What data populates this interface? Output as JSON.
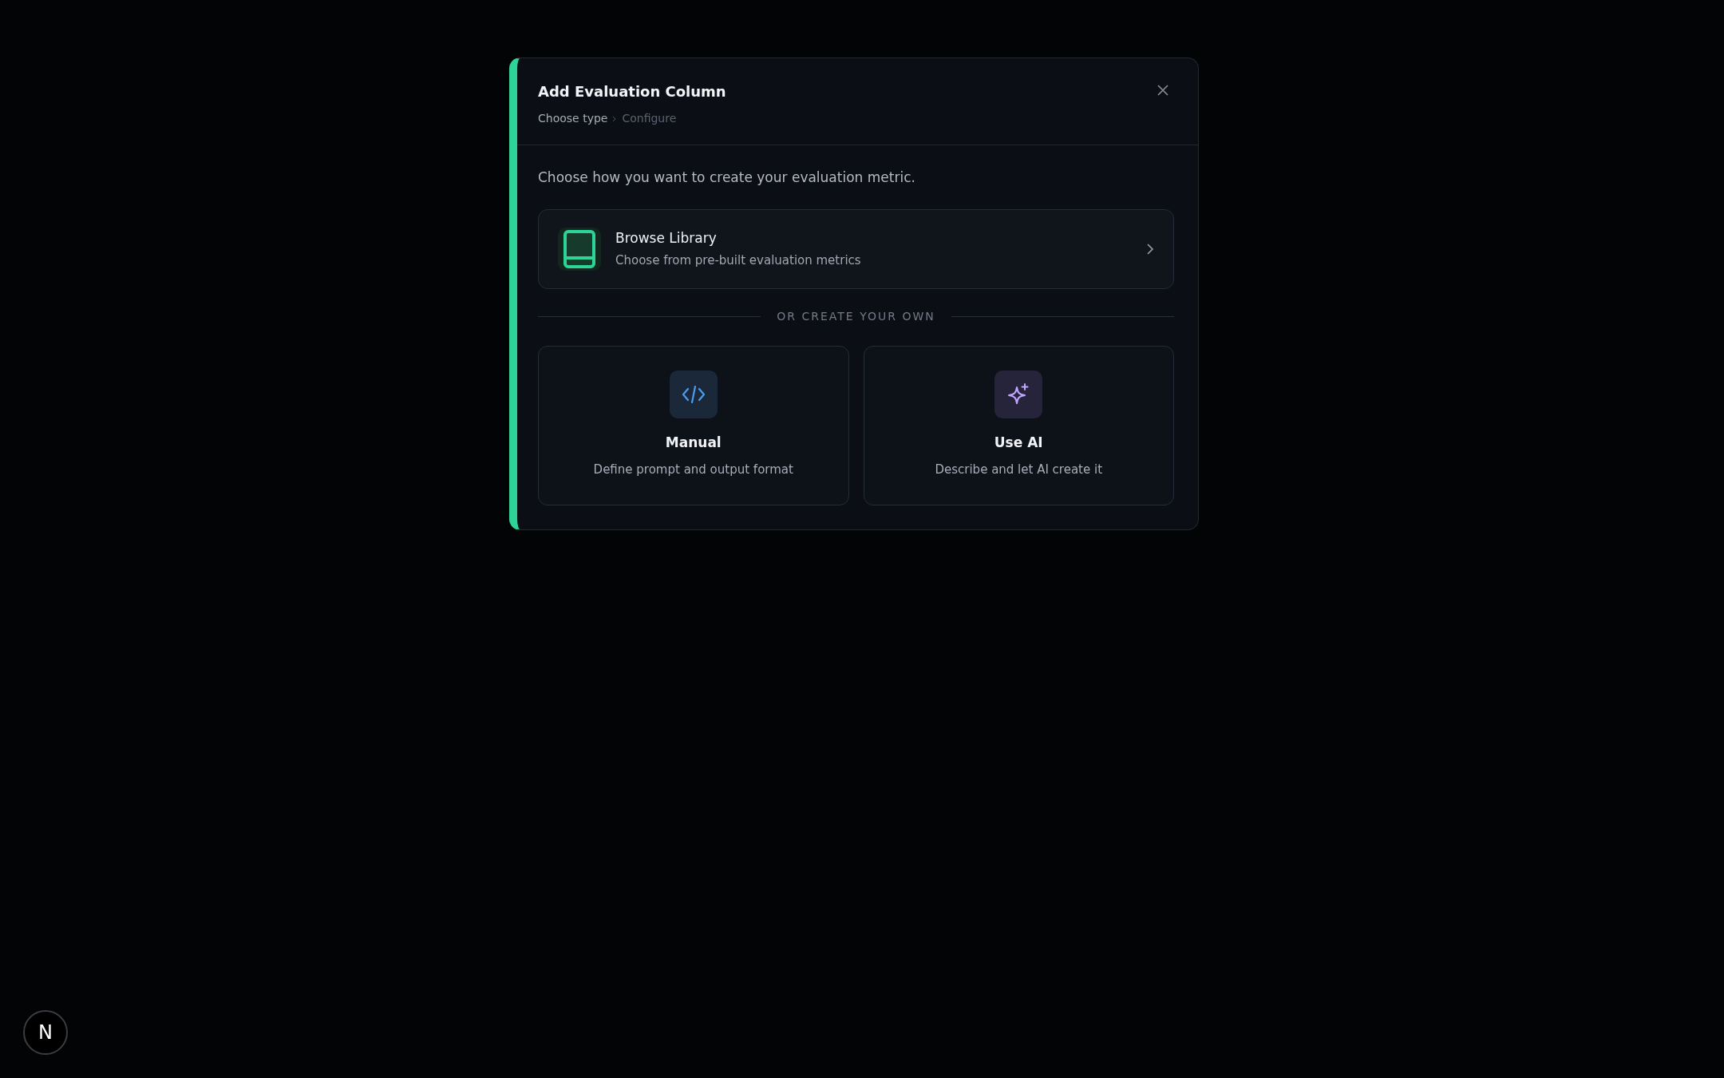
{
  "dialog": {
    "title": "Add Evaluation Column",
    "breadcrumb": [
      {
        "label": "Choose type",
        "selected": true
      },
      {
        "label": "Configure",
        "selected": false
      }
    ],
    "intro": "Choose how you want to create your evaluation metric.",
    "library": {
      "title": "Browse Library",
      "description": "Choose from pre-built evaluation metrics"
    },
    "divider": "OR CREATE YOUR OWN",
    "options": [
      {
        "kind": "manual",
        "title": "Manual",
        "description": "Define prompt and output format"
      },
      {
        "kind": "ai",
        "title": "Use AI",
        "description": "Describe and let AI create it"
      }
    ]
  },
  "devtools_button": "N"
}
